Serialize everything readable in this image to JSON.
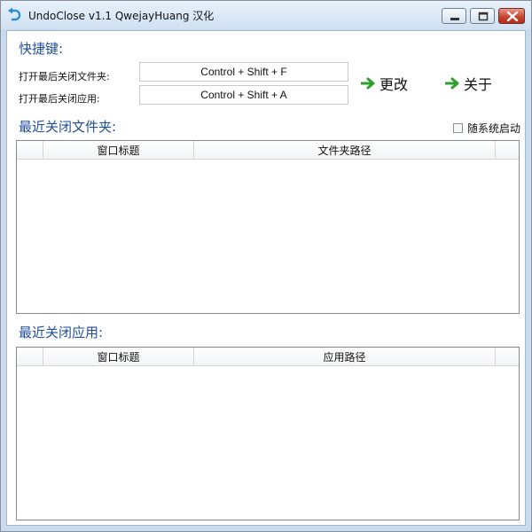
{
  "window": {
    "title": "UndoClose v1.1  QwejayHuang 汉化",
    "controls": [
      "minimize",
      "maximize",
      "close"
    ]
  },
  "hotkeys": {
    "section_title": "快捷键:",
    "folder_label": "打开最后关闭文件夹:",
    "folder_value": "Control + Shift + F",
    "app_label": "打开最后关闭应用:",
    "app_value": "Control + Shift + A"
  },
  "actions": {
    "change_label": "更改",
    "about_label": "关于"
  },
  "startup": {
    "label": "随系统启动",
    "checked": false
  },
  "folders": {
    "section_title": "最近关闭文件夹:",
    "columns": [
      "",
      "窗口标题",
      "文件夹路径",
      ""
    ],
    "rows": []
  },
  "apps": {
    "section_title": "最近关闭应用:",
    "columns": [
      "",
      "窗口标题",
      "应用路径",
      ""
    ],
    "rows": []
  },
  "colors": {
    "section_title": "#1f4e9a",
    "arrow_green": "#2e9e2e",
    "close_button": "#c84532"
  }
}
